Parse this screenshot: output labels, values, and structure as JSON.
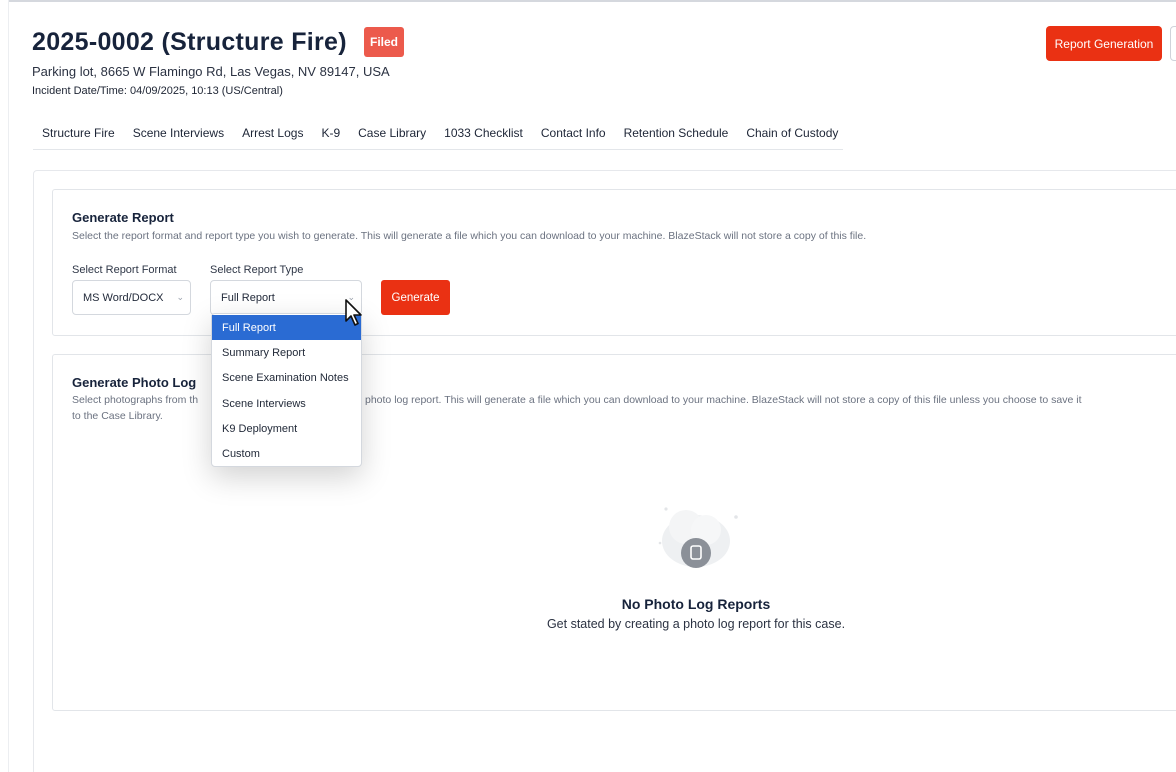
{
  "header": {
    "case_title": "2025-0002 (Structure Fire)",
    "status_badge": "Filed",
    "address": "Parking lot, 8665 W Flamingo Rd, Las Vegas, NV 89147, USA",
    "incident_datetime": "Incident Date/Time: 04/09/2025, 10:13 (US/Central)",
    "report_generation_label": "Report Generation"
  },
  "tabs": [
    {
      "label": "Structure Fire"
    },
    {
      "label": "Scene Interviews"
    },
    {
      "label": "Arrest Logs"
    },
    {
      "label": "K-9"
    },
    {
      "label": "Case Library"
    },
    {
      "label": "1033 Checklist"
    },
    {
      "label": "Contact Info"
    },
    {
      "label": "Retention Schedule"
    },
    {
      "label": "Chain of Custody"
    }
  ],
  "generate_report": {
    "title": "Generate Report",
    "description": "Select the report format and report type you wish to generate. This will generate a file which you can download to your machine. BlazeStack will not store a copy of this file.",
    "format_label": "Select Report Format",
    "format_value": "MS Word/DOCX",
    "type_label": "Select Report Type",
    "type_value": "Full Report",
    "generate_label": "Generate",
    "type_options": [
      {
        "label": "Full Report",
        "selected": true
      },
      {
        "label": "Summary Report",
        "selected": false
      },
      {
        "label": "Scene Examination Notes",
        "selected": false
      },
      {
        "label": "Scene Interviews",
        "selected": false
      },
      {
        "label": "K9 Deployment",
        "selected": false
      },
      {
        "label": "Custom",
        "selected": false
      }
    ]
  },
  "photo_log": {
    "title": "Generate Photo Log",
    "description_line1_start": "Select photographs from th",
    "description_line1_end": "photo log report. This will generate a file which you can download to your machine. BlazeStack will not store a copy of this file unless you choose to save it",
    "description_line2": "to the Case Library.",
    "empty_title": "No Photo Log Reports",
    "empty_subtitle": "Get stated by creating a photo log report for this case."
  },
  "colors": {
    "accent": "#ea3113",
    "badge": "#ec5a4c",
    "selected_option": "#2a6bd3"
  }
}
